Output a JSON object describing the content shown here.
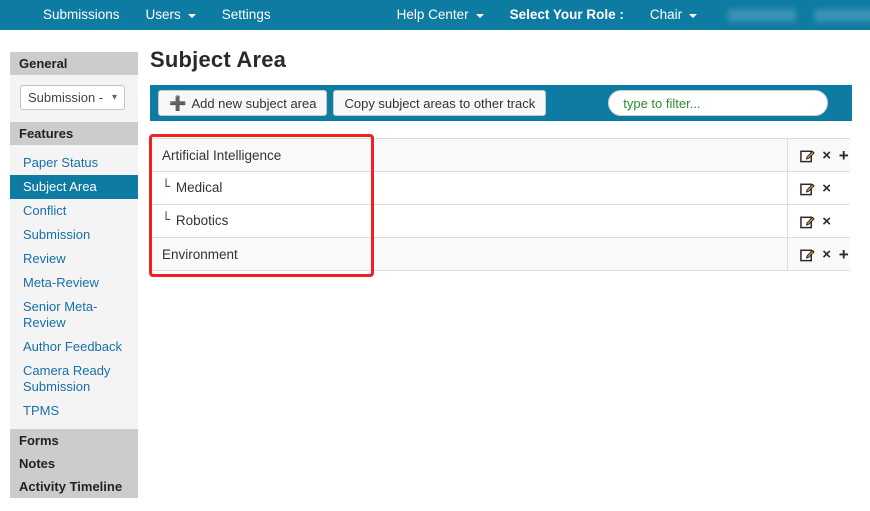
{
  "colors": {
    "brand_teal": "#0e7ba3",
    "sidebar_header": "#cccccc",
    "sidebar_body": "#f4f4f4",
    "link_blue": "#1a6fa8",
    "filter_green": "#2e8b2e",
    "annotation_red": "#ee2222",
    "row_stripe": "#f9f9f9"
  },
  "navbar": {
    "left_items": [
      {
        "label": "Submissions",
        "has_caret": false
      },
      {
        "label": "Users",
        "has_caret": true
      },
      {
        "label": "Settings",
        "has_caret": false
      }
    ],
    "right_items": [
      {
        "label": "Help Center",
        "has_caret": true,
        "bold": false
      },
      {
        "label": "Select Your Role :",
        "has_caret": false,
        "bold": true
      },
      {
        "label": "Chair",
        "has_caret": true,
        "bold": false
      }
    ]
  },
  "sidebar": {
    "general_header": "General",
    "track_select_value": "Submission -",
    "features_header": "Features",
    "features": [
      {
        "label": "Paper Status",
        "active": false
      },
      {
        "label": "Subject Area",
        "active": true
      },
      {
        "label": "Conflict",
        "active": false
      },
      {
        "label": "Submission",
        "active": false
      },
      {
        "label": "Review",
        "active": false
      },
      {
        "label": "Meta-Review",
        "active": false
      },
      {
        "label": "Senior Meta-Review",
        "active": false
      },
      {
        "label": "Author Feedback",
        "active": false
      },
      {
        "label": "Camera Ready Submission",
        "active": false
      },
      {
        "label": "TPMS",
        "active": false
      }
    ],
    "forms_header": "Forms",
    "notes_header": "Notes",
    "activity_timeline_header": "Activity Timeline"
  },
  "main": {
    "page_title": "Subject Area",
    "toolbar": {
      "add_label": "Add new subject area",
      "copy_label": "Copy subject areas to other track",
      "filter_placeholder": "type to filter...",
      "filter_value": ""
    },
    "table": {
      "rows": [
        {
          "name": "Artificial Intelligence",
          "child": false,
          "child_prefix": "",
          "actions": [
            "edit",
            "delete",
            "add"
          ]
        },
        {
          "name": "Medical",
          "child": true,
          "child_prefix": "└",
          "actions": [
            "edit",
            "delete"
          ]
        },
        {
          "name": "Robotics",
          "child": true,
          "child_prefix": "└",
          "actions": [
            "edit",
            "delete"
          ]
        },
        {
          "name": "Environment",
          "child": false,
          "child_prefix": "",
          "actions": [
            "edit",
            "delete",
            "add"
          ]
        }
      ]
    }
  },
  "icons": {
    "edit": "edit-icon",
    "delete": "×",
    "add": "+",
    "caret_down": "⌄"
  }
}
